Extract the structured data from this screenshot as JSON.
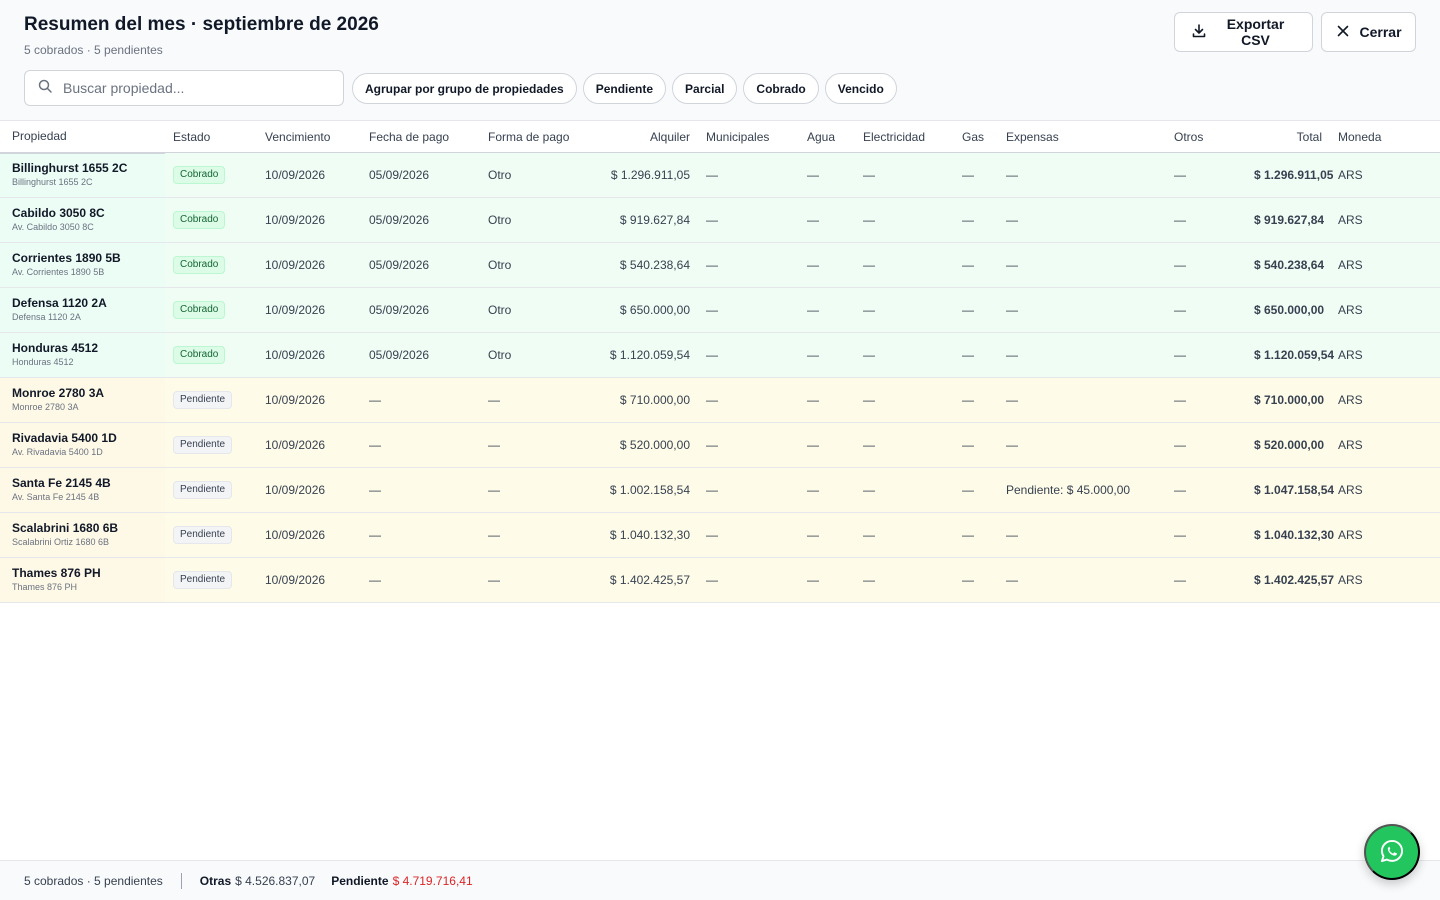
{
  "header": {
    "title": "Resumen del mes · septiembre de 2026",
    "subtitle": "5 cobrados · 5 pendientes",
    "export_label": "Exportar CSV",
    "close_label": "Cerrar"
  },
  "search": {
    "placeholder": "Buscar propiedad..."
  },
  "filters": {
    "group_label": "Agrupar por grupo de propiedades",
    "pendiente": "Pendiente",
    "parcial": "Parcial",
    "cobrado": "Cobrado",
    "vencido": "Vencido"
  },
  "table": {
    "columns": [
      "Propiedad",
      "Estado",
      "Vencimiento",
      "Fecha de pago",
      "Forma de pago",
      "Alquiler",
      "Municipales",
      "Agua",
      "Electricidad",
      "Gas",
      "Expensas",
      "Otros",
      "Total",
      "Moneda"
    ],
    "rows": [
      {
        "name": "Billinghurst 1655 2C",
        "address": "Billinghurst 1655 2C",
        "status": "Cobrado",
        "status_key": "cobrado",
        "due": "10/09/2026",
        "paid": "05/09/2026",
        "method": "Otro",
        "rent": "$ 1.296.911,05",
        "municipal": "—",
        "water": "—",
        "electricity": "—",
        "gas": "—",
        "expenses": "—",
        "other": "—",
        "total": "$ 1.296.911,05",
        "currency": "ARS"
      },
      {
        "name": "Cabildo 3050 8C",
        "address": "Av. Cabildo 3050 8C",
        "status": "Cobrado",
        "status_key": "cobrado",
        "due": "10/09/2026",
        "paid": "05/09/2026",
        "method": "Otro",
        "rent": "$ 919.627,84",
        "municipal": "—",
        "water": "—",
        "electricity": "—",
        "gas": "—",
        "expenses": "—",
        "other": "—",
        "total": "$ 919.627,84",
        "currency": "ARS"
      },
      {
        "name": "Corrientes 1890 5B",
        "address": "Av. Corrientes 1890 5B",
        "status": "Cobrado",
        "status_key": "cobrado",
        "due": "10/09/2026",
        "paid": "05/09/2026",
        "method": "Otro",
        "rent": "$ 540.238,64",
        "municipal": "—",
        "water": "—",
        "electricity": "—",
        "gas": "—",
        "expenses": "—",
        "other": "—",
        "total": "$ 540.238,64",
        "currency": "ARS"
      },
      {
        "name": "Defensa 1120 2A",
        "address": "Defensa 1120 2A",
        "status": "Cobrado",
        "status_key": "cobrado",
        "due": "10/09/2026",
        "paid": "05/09/2026",
        "method": "Otro",
        "rent": "$ 650.000,00",
        "municipal": "—",
        "water": "—",
        "electricity": "—",
        "gas": "—",
        "expenses": "—",
        "other": "—",
        "total": "$ 650.000,00",
        "currency": "ARS"
      },
      {
        "name": "Honduras 4512",
        "address": "Honduras 4512",
        "status": "Cobrado",
        "status_key": "cobrado",
        "due": "10/09/2026",
        "paid": "05/09/2026",
        "method": "Otro",
        "rent": "$ 1.120.059,54",
        "municipal": "—",
        "water": "—",
        "electricity": "—",
        "gas": "—",
        "expenses": "—",
        "other": "—",
        "total": "$ 1.120.059,54",
        "currency": "ARS"
      },
      {
        "name": "Monroe 2780 3A",
        "address": "Monroe 2780 3A",
        "status": "Pendiente",
        "status_key": "pendiente",
        "due": "10/09/2026",
        "paid": "—",
        "method": "—",
        "rent": "$ 710.000,00",
        "municipal": "—",
        "water": "—",
        "electricity": "—",
        "gas": "—",
        "expenses": "—",
        "other": "—",
        "total": "$ 710.000,00",
        "currency": "ARS"
      },
      {
        "name": "Rivadavia 5400 1D",
        "address": "Av. Rivadavia 5400 1D",
        "status": "Pendiente",
        "status_key": "pendiente",
        "due": "10/09/2026",
        "paid": "—",
        "method": "—",
        "rent": "$ 520.000,00",
        "municipal": "—",
        "water": "—",
        "electricity": "—",
        "gas": "—",
        "expenses": "—",
        "other": "—",
        "total": "$ 520.000,00",
        "currency": "ARS"
      },
      {
        "name": "Santa Fe 2145 4B",
        "address": "Av. Santa Fe 2145 4B",
        "status": "Pendiente",
        "status_key": "pendiente",
        "due": "10/09/2026",
        "paid": "—",
        "method": "—",
        "rent": "$ 1.002.158,54",
        "municipal": "—",
        "water": "—",
        "electricity": "—",
        "gas": "—",
        "expenses": "Pendiente: $ 45.000,00",
        "other": "—",
        "total": "$ 1.047.158,54",
        "currency": "ARS"
      },
      {
        "name": "Scalabrini 1680 6B",
        "address": "Scalabrini Ortiz 1680 6B",
        "status": "Pendiente",
        "status_key": "pendiente",
        "due": "10/09/2026",
        "paid": "—",
        "method": "—",
        "rent": "$ 1.040.132,30",
        "municipal": "—",
        "water": "—",
        "electricity": "—",
        "gas": "—",
        "expenses": "—",
        "other": "—",
        "total": "$ 1.040.132,30",
        "currency": "ARS"
      },
      {
        "name": "Thames 876 PH",
        "address": "Thames 876 PH",
        "status": "Pendiente",
        "status_key": "pendiente",
        "due": "10/09/2026",
        "paid": "—",
        "method": "—",
        "rent": "$ 1.402.425,57",
        "municipal": "—",
        "water": "—",
        "electricity": "—",
        "gas": "—",
        "expenses": "—",
        "other": "—",
        "total": "$ 1.402.425,57",
        "currency": "ARS"
      }
    ]
  },
  "footer": {
    "counts": "5 cobrados · 5 pendientes",
    "otras_label": "Otras",
    "otras_value": "$ 4.526.837,07",
    "pendiente_label": "Pendiente",
    "pendiente_value": "$ 4.719.716,41"
  },
  "icons": {
    "export": "download-icon",
    "close": "close-icon",
    "search": "search-icon",
    "whatsapp": "whatsapp-icon"
  },
  "colors": {
    "cobrado_row": "#f0fdf4",
    "pendiente_row": "#fefce8",
    "pending_text": "#dc2626",
    "whatsapp": "#22c55e"
  }
}
